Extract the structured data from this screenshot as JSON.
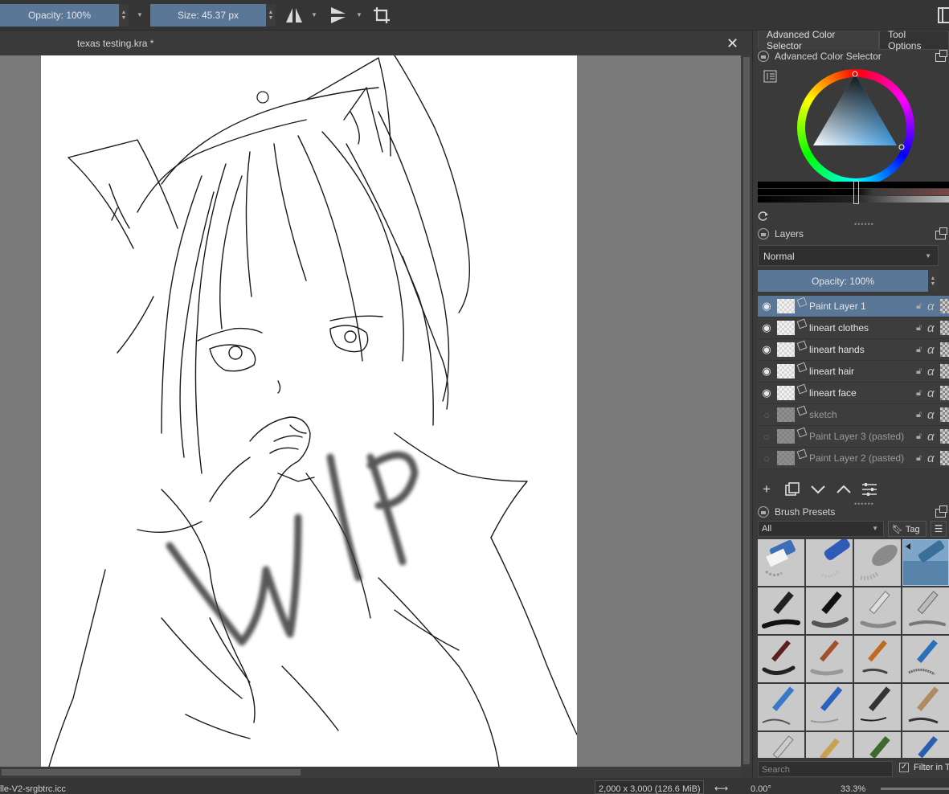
{
  "toolbar": {
    "opacity_label": "Opacity: 100%",
    "size_label": "Size: 45.37 px"
  },
  "document": {
    "tab_title": "texas testing.kra *",
    "close_glyph": "✕",
    "canvas_overlay_text": "WIP"
  },
  "status_bar": {
    "color_profile": "lle-V2-srgbtrc.icc",
    "image_info": "2,000 x 3,000 (126.6 MiB)",
    "rotation": "0.00°",
    "zoom": "33.3%"
  },
  "docker": {
    "tabs": [
      "Advanced Color Selector",
      "Tool Options"
    ],
    "color_selector": {
      "title": "Advanced Color Selector",
      "current_color": "#3a9ae0"
    },
    "layers": {
      "title": "Layers",
      "blend_mode": "Normal",
      "opacity_label": "Opacity:  100%",
      "items": [
        {
          "name": "Paint Layer 1",
          "visible": true,
          "selected": true
        },
        {
          "name": "lineart clothes",
          "visible": true,
          "selected": false
        },
        {
          "name": "lineart hands",
          "visible": true,
          "selected": false
        },
        {
          "name": "lineart hair",
          "visible": true,
          "selected": false
        },
        {
          "name": "lineart face",
          "visible": true,
          "selected": false
        },
        {
          "name": "sketch",
          "visible": false,
          "selected": false
        },
        {
          "name": "Paint Layer 3 (pasted)",
          "visible": false,
          "selected": false
        },
        {
          "name": "Paint Layer 2 (pasted)",
          "visible": false,
          "selected": false
        }
      ],
      "alpha_glyph": "α"
    },
    "brush_presets": {
      "title": "Brush Presets",
      "tag_filter": "All",
      "tag_button": "Tag",
      "search_placeholder": "Search",
      "filter_label": "Filter in T"
    }
  },
  "colors": {
    "accent": "#5a7797",
    "panel_bg": "#3a3a3a",
    "canvas_bg": "#7a7a7a"
  }
}
